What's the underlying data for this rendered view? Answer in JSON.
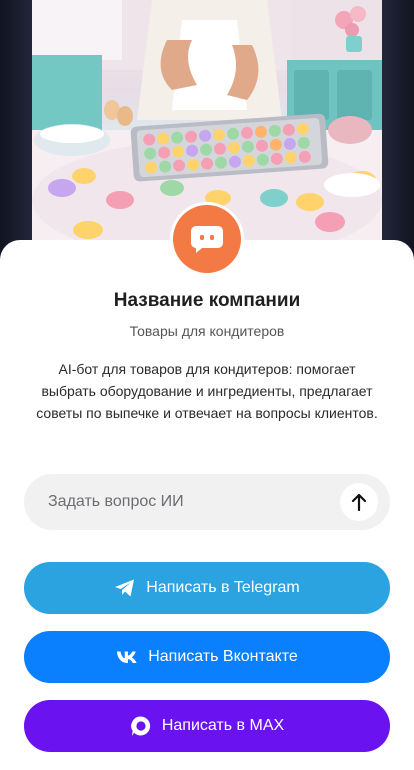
{
  "hero": {
    "image_description_icon": "macarons-cooking-illustration"
  },
  "company": {
    "name": "Название компании",
    "subtitle": "Товары для кондитеров",
    "description": "AI-бот для товаров для кондитеров: помогает выбрать оборудование и ингредиенты, предлагает советы по выпечке и отвечает на вопросы клиентов.",
    "avatar_icon": "chat-bot-icon"
  },
  "ask": {
    "placeholder": "Задать вопрос ИИ",
    "value": "",
    "send_icon": "arrow-up-icon"
  },
  "actions": {
    "telegram": {
      "label": "Написать в Telegram",
      "icon": "telegram-icon",
      "color": "#2aa3e0"
    },
    "vk": {
      "label": "Написать Вконтакте",
      "icon": "vk-icon",
      "color": "#0a80ff"
    },
    "max": {
      "label": "Написать в MAX",
      "icon": "max-icon",
      "color": "#6b12f0"
    }
  },
  "colors": {
    "avatar_bg": "#f47a45",
    "card_bg": "#ffffff",
    "page_bg": "#1c1f2c"
  }
}
